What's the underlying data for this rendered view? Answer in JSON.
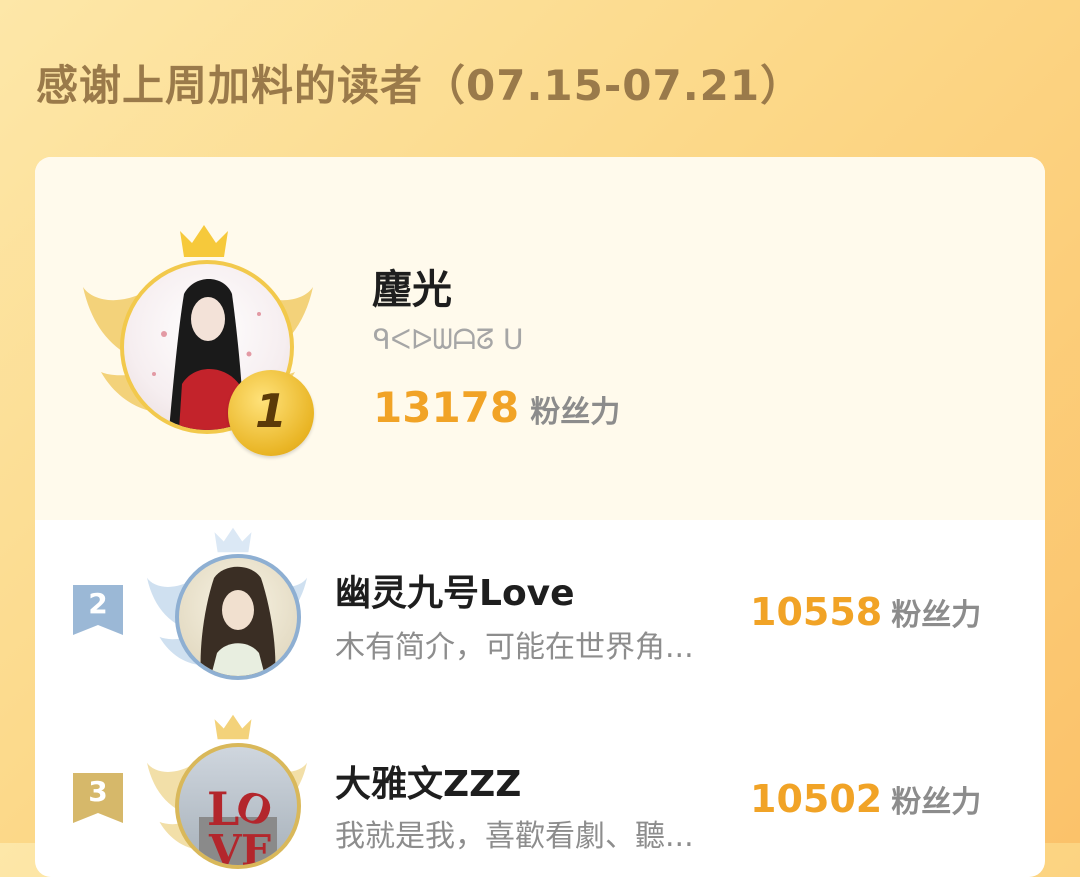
{
  "header": {
    "title": "感谢上周加料的读者（07.15-07.21）"
  },
  "score_unit": "粉丝力",
  "readers": [
    {
      "rank": "1",
      "name": "麈光",
      "bio": "ᑫᐸᐅᗯᗩᘔ ᑌ",
      "score": "13178"
    },
    {
      "rank": "2",
      "name": "幽灵九号Love",
      "bio": "木有简介，可能在世界角...",
      "score": "10558"
    },
    {
      "rank": "3",
      "name": "大雅文ZZZ",
      "bio": "我就是我，喜歡看劇、聽...",
      "score": "10502"
    }
  ],
  "colors": {
    "accent": "#f1a326",
    "gold": "#e9b525",
    "silver": "#9bb8d6",
    "bronze": "#d6b86a"
  }
}
